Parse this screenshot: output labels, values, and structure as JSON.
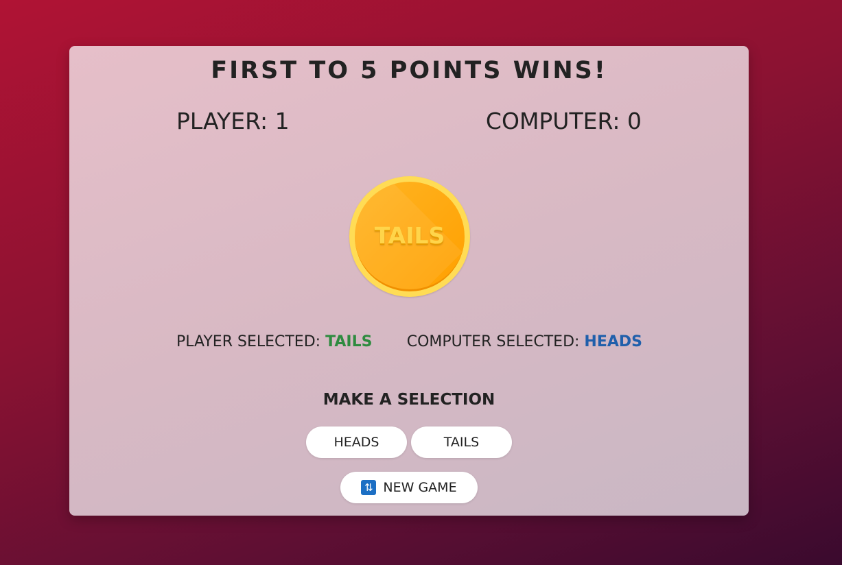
{
  "title": "FIRST TO 5 POINTS WINS!",
  "scores": {
    "player_label": "PLAYER: 1",
    "computer_label": "COMPUTER: 0"
  },
  "coin": {
    "face": "TAILS",
    "colors": {
      "rim": "#ffdc55",
      "face": "#ffaa12",
      "text": "#ffd54a"
    }
  },
  "selections": {
    "player_prefix": "PLAYER SELECTED: ",
    "player_value": "TAILS",
    "player_color": "#2e8b3f",
    "computer_prefix": "COMPUTER SELECTED: ",
    "computer_value": "HEADS",
    "computer_color": "#1f5fab"
  },
  "controls": {
    "prompt": "MAKE A SELECTION",
    "heads_label": "HEADS",
    "tails_label": "TAILS",
    "new_game_label": "NEW GAME",
    "new_game_icon": "refresh-icon"
  }
}
